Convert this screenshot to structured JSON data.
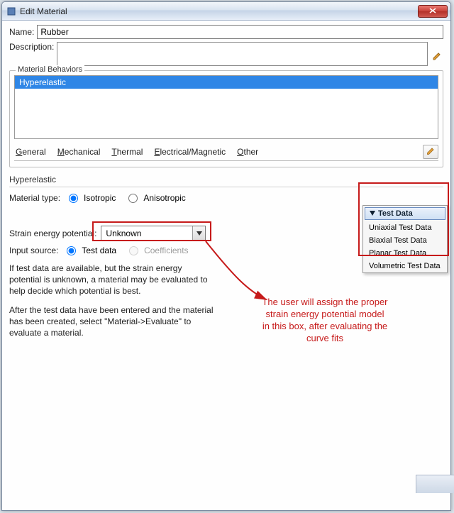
{
  "window": {
    "title": "Edit Material"
  },
  "fields": {
    "name_label": "Name:",
    "name_value": "Rubber",
    "description_label": "Description:"
  },
  "behaviors": {
    "legend": "Material Behaviors",
    "items": [
      "Hyperelastic"
    ]
  },
  "tabs": {
    "general": "General",
    "mechanical": "Mechanical",
    "thermal": "Thermal",
    "electrical": "Electrical/Magnetic",
    "other": "Other"
  },
  "hyper": {
    "section_title": "Hyperelastic",
    "material_type_label": "Material type:",
    "isotropic": "Isotropic",
    "anisotropic": "Anisotropic",
    "sep_label": "Strain energy potential:",
    "sep_value": "Unknown",
    "input_source_label": "Input source:",
    "test_data": "Test data",
    "coefficients": "Coefficients",
    "info_p1": "If test data are available, but the strain energy potential is unknown, a material may be evaluated to help decide which potential is best.",
    "info_p2": "After the test data have been entered and the material has been created, select \"Material->Evaluate\" to evaluate a material."
  },
  "testdata_menu": {
    "header": "Test Data",
    "items": [
      "Uniaxial Test Data",
      "Biaxial Test Data",
      "Planar Test Data",
      "Volumetric Test Data"
    ]
  },
  "annotation": {
    "text": "The user will assign the proper strain energy potential model in this box, after evaluating the curve fits"
  }
}
